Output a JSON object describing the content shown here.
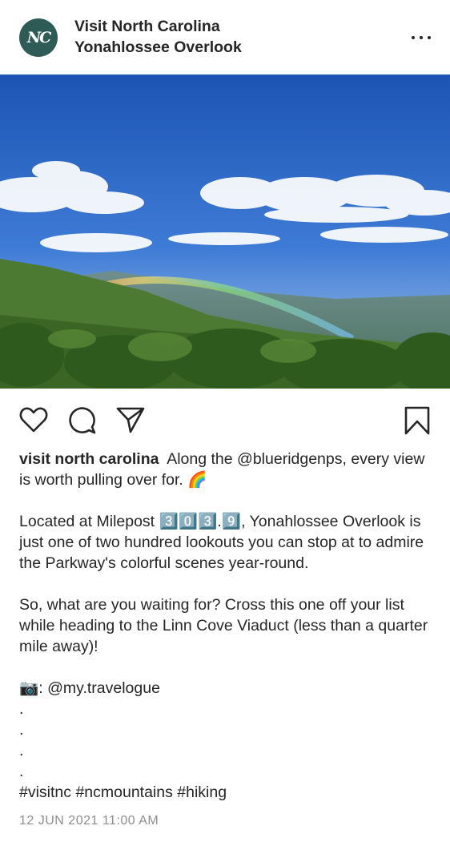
{
  "header": {
    "avatar_text": "NC",
    "account_name": "Visit North Carolina",
    "location": "Yonahlossee Overlook",
    "more_icon": "more-horizontal-icon"
  },
  "photo": {
    "alt": "Rainbow over forested mountain overlook under blue sky",
    "sky_top": "#1f58b5",
    "sky_bottom": "#5b8fdc",
    "forest": "#3f6f2a"
  },
  "actions": {
    "like_icon": "heart-icon",
    "comment_icon": "comment-icon",
    "share_icon": "send-icon",
    "save_icon": "bookmark-icon"
  },
  "caption": {
    "username": "visit north carolina",
    "line1": "Along the @blueridgenps, every view is worth pulling over for. 🌈",
    "line2_prefix": "Located at Milepost ",
    "milepost": "3️⃣0️⃣3️⃣.9️⃣",
    "line2_suffix": ", Yonahlossee Overlook is just one of two hundred lookouts you can stop at to admire the Parkway's colorful scenes year-round.",
    "line3": "So, what are you waiting for? Cross this one off your list while heading to the Linn Cove Viaduct (less than a quarter mile away)!",
    "credit_emoji": "📷",
    "credit_text": ": @my.travelogue",
    "dots": [
      ".",
      ".",
      ".",
      "."
    ],
    "hashtags": "#visitnc #ncmountains #hiking"
  },
  "timestamp": "12 JUN 2021 11:00 AM"
}
